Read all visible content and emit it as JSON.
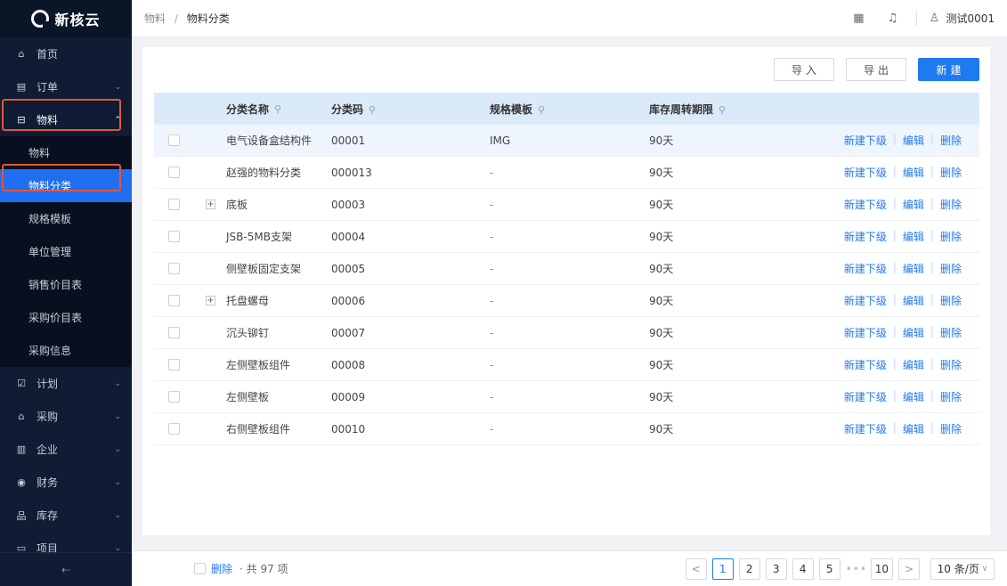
{
  "app": {
    "name": "新核云"
  },
  "sidebar": {
    "items_top": [
      {
        "icon": "home-icon",
        "glyph": "⌂",
        "label": "首页",
        "arrow": ""
      },
      {
        "icon": "order-icon",
        "glyph": "▤",
        "label": "订单",
        "arrow": "⌄"
      }
    ],
    "expanded": {
      "icon": "material-icon",
      "glyph": "⊟",
      "label": "物料",
      "arrow": "⌃"
    },
    "submenu": [
      {
        "label": "物料",
        "active": false
      },
      {
        "label": "物料分类",
        "active": true
      },
      {
        "label": "规格模板",
        "active": false
      },
      {
        "label": "单位管理",
        "active": false
      },
      {
        "label": "销售价目表",
        "active": false
      },
      {
        "label": "采购价目表",
        "active": false
      },
      {
        "label": "采购信息",
        "active": false
      }
    ],
    "items_bottom": [
      {
        "icon": "plan-icon",
        "glyph": "☑",
        "label": "计划",
        "arrow": "⌄"
      },
      {
        "icon": "purchase-icon",
        "glyph": "⌂",
        "label": "采购",
        "arrow": "⌄"
      },
      {
        "icon": "enterprise-icon",
        "glyph": "▥",
        "label": "企业",
        "arrow": "⌄"
      },
      {
        "icon": "finance-icon",
        "glyph": "◉",
        "label": "财务",
        "arrow": "⌄"
      },
      {
        "icon": "inventory-icon",
        "glyph": "品",
        "label": "库存",
        "arrow": "⌄"
      },
      {
        "icon": "project-icon",
        "glyph": "▭",
        "label": "项目",
        "arrow": "⌄"
      }
    ],
    "collapse_glyph": "⇠"
  },
  "header": {
    "breadcrumb": [
      "物料",
      "物料分类"
    ],
    "user": "测试0001"
  },
  "toolbar": {
    "import_label": "导入",
    "export_label": "导出",
    "new_label": "新建"
  },
  "table": {
    "columns": [
      "分类名称",
      "分类码",
      "规格模板",
      "库存周转期限"
    ],
    "actions": [
      "新建下级",
      "编辑",
      "删除"
    ],
    "rows": [
      {
        "name": "电气设备盒结构件",
        "code": "00001",
        "template": "IMG",
        "period": "90天",
        "expandable": false,
        "hover": true
      },
      {
        "name": "赵强的物料分类",
        "code": "000013",
        "template": "-",
        "period": "90天",
        "expandable": false,
        "hover": false
      },
      {
        "name": "底板",
        "code": "00003",
        "template": "-",
        "period": "90天",
        "expandable": true,
        "hover": false
      },
      {
        "name": "JSB-5MB支架",
        "code": "00004",
        "template": "-",
        "period": "90天",
        "expandable": false,
        "hover": false
      },
      {
        "name": "侧壁板固定支架",
        "code": "00005",
        "template": "-",
        "period": "90天",
        "expandable": false,
        "hover": false
      },
      {
        "name": "托盘螺母",
        "code": "00006",
        "template": "-",
        "period": "90天",
        "expandable": true,
        "hover": false
      },
      {
        "name": "沉头铆钉",
        "code": "00007",
        "template": "-",
        "period": "90天",
        "expandable": false,
        "hover": false
      },
      {
        "name": "左侧壁板组件",
        "code": "00008",
        "template": "-",
        "period": "90天",
        "expandable": false,
        "hover": false
      },
      {
        "name": "左侧壁板",
        "code": "00009",
        "template": "-",
        "period": "90天",
        "expandable": false,
        "hover": false
      },
      {
        "name": "右侧壁板组件",
        "code": "00010",
        "template": "-",
        "period": "90天",
        "expandable": false,
        "hover": false
      }
    ]
  },
  "footer": {
    "delete_label": "删除",
    "total_label": "· 共 97 项",
    "pages": [
      "1",
      "2",
      "3",
      "4",
      "5"
    ],
    "current_page": "1",
    "ellipsis": "•••",
    "last_page": "10",
    "prev": "<",
    "next": ">",
    "page_size": "10 条/页"
  },
  "colors": {
    "accent": "#1f7af0",
    "sidebar_bg": "#0f1c33",
    "highlight": "#e4553c"
  }
}
